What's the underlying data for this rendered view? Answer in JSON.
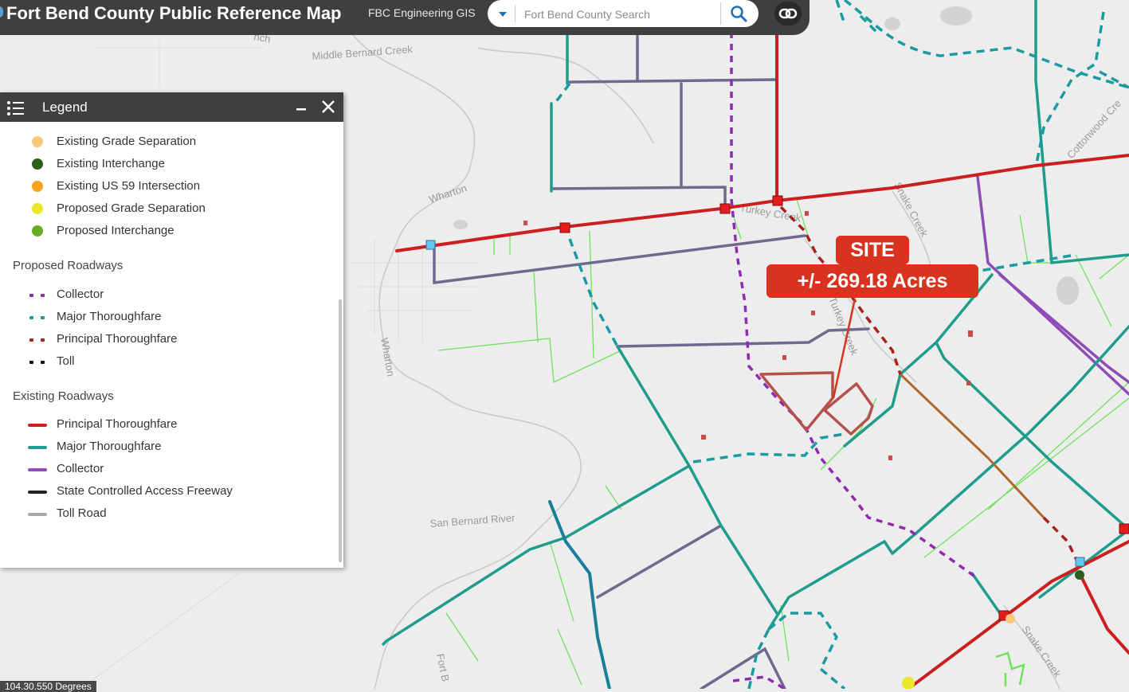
{
  "header": {
    "title": "Fort Bend County Public Reference Map",
    "subtitle": "FBC Engineering GIS",
    "search_placeholder": "Fort Bend County Search"
  },
  "icons": {
    "search": "search-icon",
    "link": "link-icon",
    "dropdown": "chevron-down-icon",
    "legend_list": "list-icon",
    "minimize": "minimize-icon",
    "close": "close-icon"
  },
  "legend": {
    "title": "Legend",
    "points": [
      {
        "label": "Existing Grade Separation",
        "color": "#f9c77a"
      },
      {
        "label": "Existing Interchange",
        "color": "#2f5d1a"
      },
      {
        "label": "Existing US 59 Intersection",
        "color": "#f7a21b"
      },
      {
        "label": "Proposed Grade Separation",
        "color": "#e8e826"
      },
      {
        "label": "Proposed Interchange",
        "color": "#6aa827"
      }
    ],
    "proposed_heading": "Proposed Roadways",
    "proposed": [
      {
        "label": "Collector",
        "color": "#8e2bb0"
      },
      {
        "label": "Major Thoroughfare",
        "color": "#1b9aa0"
      },
      {
        "label": "Principal Thoroughfare",
        "color": "#a8211f"
      },
      {
        "label": "Toll",
        "color": "#111111"
      }
    ],
    "existing_heading": "Existing Roadways",
    "existing": [
      {
        "label": "Principal Thoroughfare",
        "color": "#cc1f1f"
      },
      {
        "label": "Major Thoroughfare",
        "color": "#1f9c9a"
      },
      {
        "label": "Collector",
        "color": "#8e4db5"
      },
      {
        "label": "State Controlled Access Freeway",
        "color": "#222222"
      },
      {
        "label": "Toll Road",
        "color": "#a9a9a9"
      }
    ]
  },
  "map": {
    "labels": [
      "Middle Bernard Creek",
      "Wharton",
      "Wharton",
      "San Bernard River",
      "Snake Creek",
      "Snake Creek",
      "Cottonwood Cre",
      "Turkey Creek",
      "Turkey Creek",
      "Fort B",
      "nch"
    ],
    "site_label": "SITE",
    "site_acres": "+/- 269.18 Acres",
    "coords": "104.30.550 Degrees"
  }
}
